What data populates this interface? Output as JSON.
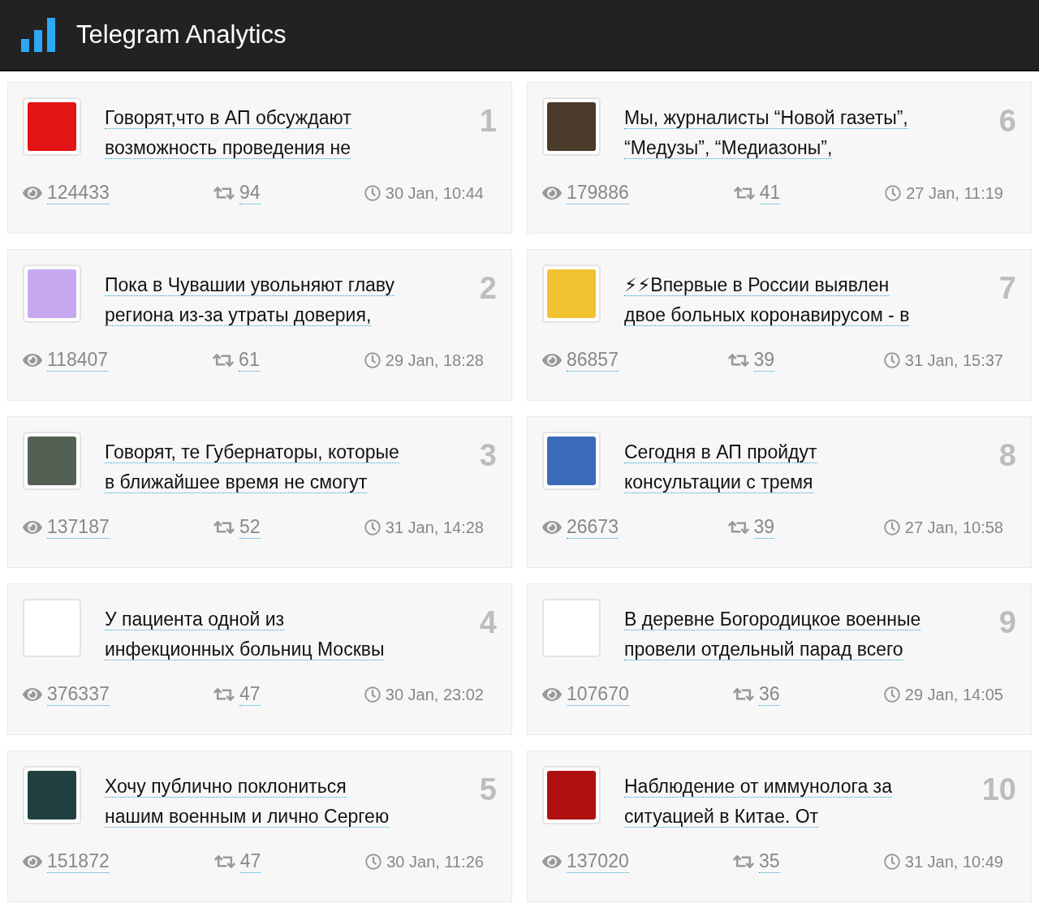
{
  "header": {
    "title": "Telegram Analytics"
  },
  "posts": [
    {
      "rank": "1",
      "title_lines": [
        "Говорят,что в АП обсуждают",
        "возможность проведения не"
      ],
      "views": "124433",
      "reposts": "94",
      "date": "30 Jan, 10:44"
    },
    {
      "rank": "6",
      "title_lines": [
        "Мы, журналисты “Новой газеты”,",
        "“Медузы”, “Медиазоны”,"
      ],
      "views": "179886",
      "reposts": "41",
      "date": "27 Jan, 11:19"
    },
    {
      "rank": "2",
      "title_lines": [
        "Пока в Чувашии увольняют главу",
        "региона из-за утраты доверия,"
      ],
      "views": "118407",
      "reposts": "61",
      "date": "29 Jan, 18:28"
    },
    {
      "rank": "7",
      "title_lines": [
        "⚡⚡Впервые в России выявлен",
        "двое больных коронавирусом - в"
      ],
      "views": "86857",
      "reposts": "39",
      "date": "31 Jan, 15:37"
    },
    {
      "rank": "3",
      "title_lines": [
        "Говорят, те Губернаторы, которые",
        "в ближайшее время не смогут"
      ],
      "views": "137187",
      "reposts": "52",
      "date": "31 Jan, 14:28"
    },
    {
      "rank": "8",
      "title_lines": [
        "Сегодня в АП пройдут",
        "консультации с тремя"
      ],
      "views": "26673",
      "reposts": "39",
      "date": "27 Jan, 10:58"
    },
    {
      "rank": "4",
      "title_lines": [
        "У пациента одной из",
        "инфекционных больниц Москвы"
      ],
      "views": "376337",
      "reposts": "47",
      "date": "30 Jan, 23:02"
    },
    {
      "rank": "9",
      "title_lines": [
        "В деревне Богородицкое военные",
        "провели отдельный парад всего"
      ],
      "views": "107670",
      "reposts": "36",
      "date": "29 Jan, 14:05"
    },
    {
      "rank": "5",
      "title_lines": [
        "Хочу публично поклониться",
        "нашим военным и лично Сергею"
      ],
      "views": "151872",
      "reposts": "47",
      "date": "30 Jan, 11:26"
    },
    {
      "rank": "10",
      "title_lines": [
        "Наблюдение от иммунолога за",
        "ситуацией в Китае. От"
      ],
      "views": "137020",
      "reposts": "35",
      "date": "31 Jan, 10:49"
    }
  ]
}
